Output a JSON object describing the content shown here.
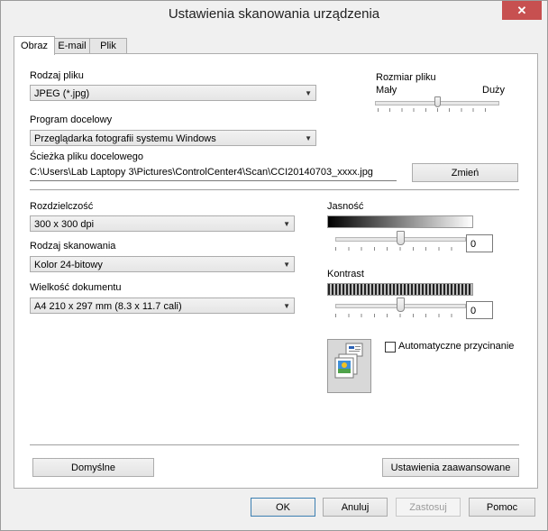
{
  "window": {
    "title": "Ustawienia skanowania urządzenia",
    "close_glyph": "✕"
  },
  "tabs": [
    {
      "label": "Obraz",
      "active": true
    },
    {
      "label": "E-mail",
      "active": false
    },
    {
      "label": "Plik",
      "active": false
    }
  ],
  "file_type": {
    "label": "Rodzaj pliku",
    "value": "JPEG (*.jpg)"
  },
  "file_size": {
    "label": "Rozmiar pliku",
    "min_label": "Mały",
    "max_label": "Duży",
    "level_fraction": 0.5
  },
  "target_app": {
    "label": "Program docelowy",
    "value": "Przeglądarka fotografii systemu Windows"
  },
  "file_path": {
    "label": "Ścieżka pliku docelowego",
    "value": "C:\\Users\\Lab Laptopy 3\\Pictures\\ControlCenter4\\Scan\\CCI20140703_xxxx.jpg",
    "change_label": "Zmień"
  },
  "resolution": {
    "label": "Rozdzielczość",
    "value": "300 x 300 dpi"
  },
  "scan_type": {
    "label": "Rodzaj skanowania",
    "value": "Kolor 24-bitowy"
  },
  "doc_size": {
    "label": "Wielkość dokumentu",
    "value": "A4 210 x 297 mm (8.3 x 11.7 cali)"
  },
  "brightness": {
    "label": "Jasność",
    "value": "0",
    "level_fraction": 0.5
  },
  "contrast": {
    "label": "Kontrast",
    "value": "0",
    "level_fraction": 0.5
  },
  "auto_crop": {
    "label": "Automatyczne przycinanie",
    "checked": false
  },
  "buttons": {
    "defaults": "Domyślne",
    "advanced": "Ustawienia zaawansowane",
    "ok": "OK",
    "cancel": "Anuluj",
    "apply": "Zastosuj",
    "help": "Pomoc"
  },
  "colors": {
    "accent_border": "#3c7fb1",
    "close_red": "#c75050"
  }
}
